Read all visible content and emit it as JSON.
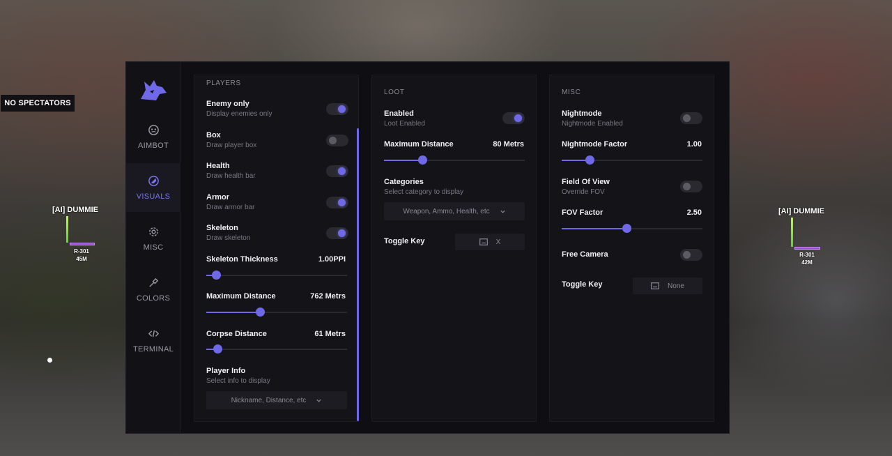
{
  "overlay": {
    "spectators": "NO SPECTATORS",
    "esp_left": {
      "name": "[AI] DUMMIE",
      "weapon": "R-301",
      "distance": "45M"
    },
    "esp_right": {
      "name": "[AI] DUMMIE",
      "weapon": "R-301",
      "distance": "42M"
    }
  },
  "colors": {
    "accent": "#6f69e8",
    "panel": "#141318",
    "window": "#0f0e12"
  },
  "sidebar": {
    "items": [
      {
        "label": "AIMBOT",
        "icon": "face-icon",
        "active": false
      },
      {
        "label": "VISUALS",
        "icon": "visuals-icon",
        "active": true
      },
      {
        "label": "MISC",
        "icon": "gear-icon",
        "active": false
      },
      {
        "label": "COLORS",
        "icon": "eyedropper-icon",
        "active": false
      },
      {
        "label": "TERMINAL",
        "icon": "code-icon",
        "active": false
      }
    ]
  },
  "players": {
    "title": "PLAYERS",
    "toggles": [
      {
        "title": "Enemy only",
        "sub": "Display enemies only",
        "on": true
      },
      {
        "title": "Box",
        "sub": "Draw player box",
        "on": false
      },
      {
        "title": "Health",
        "sub": "Draw health bar",
        "on": true
      },
      {
        "title": "Armor",
        "sub": "Draw armor bar",
        "on": true
      },
      {
        "title": "Skeleton",
        "sub": "Draw skeleton",
        "on": true
      }
    ],
    "sliders": [
      {
        "title": "Skeleton Thickness",
        "value": "1.00PPI",
        "fraction": 0.07
      },
      {
        "title": "Maximum Distance",
        "value": "762 Metrs",
        "fraction": 0.38
      },
      {
        "title": "Corpse Distance",
        "value": "61 Metrs",
        "fraction": 0.08
      }
    ],
    "player_info": {
      "title": "Player Info",
      "sub": "Select info to display",
      "value": "Nickname, Distance, etc"
    }
  },
  "loot": {
    "title": "LOOT",
    "enabled": {
      "title": "Enabled",
      "sub": "Loot Enabled",
      "on": true
    },
    "max_distance": {
      "title": "Maximum Distance",
      "value": "80 Metrs",
      "fraction": 0.27
    },
    "categories": {
      "title": "Categories",
      "sub": "Select category to display",
      "value": "Weapon, Ammo, Health, etc"
    },
    "toggle_key": {
      "title": "Toggle Key",
      "value": "X"
    }
  },
  "misc": {
    "title": "MISC",
    "nightmode": {
      "title": "Nightmode",
      "sub": "Nightmode Enabled",
      "on": false
    },
    "nightmode_factor": {
      "title": "Nightmode Factor",
      "value": "1.00",
      "fraction": 0.2
    },
    "fov": {
      "title": "Field Of View",
      "sub": "Override FOV",
      "on": false
    },
    "fov_factor": {
      "title": "FOV Factor",
      "value": "2.50",
      "fraction": 0.46
    },
    "free_camera": {
      "title": "Free Camera",
      "on": false
    },
    "toggle_key": {
      "title": "Toggle Key",
      "value": "None"
    }
  }
}
